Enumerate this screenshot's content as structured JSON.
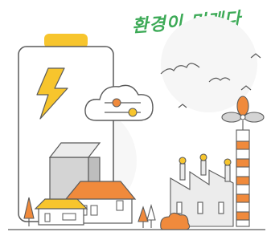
{
  "headline": {
    "text": "환경이 미래다"
  },
  "colors": {
    "accent_green": "#3daa57",
    "energy_orange": "#f08a3c",
    "energy_yellow": "#f7c52d",
    "line_gray": "#5a5a5a",
    "building_gray": "#d4d4d4"
  },
  "icons": [
    "battery-icon",
    "lightning-bolt-icon",
    "cloud-slider-icon",
    "bird-icon",
    "windmill-icon",
    "factory-icon",
    "tree-icon"
  ]
}
